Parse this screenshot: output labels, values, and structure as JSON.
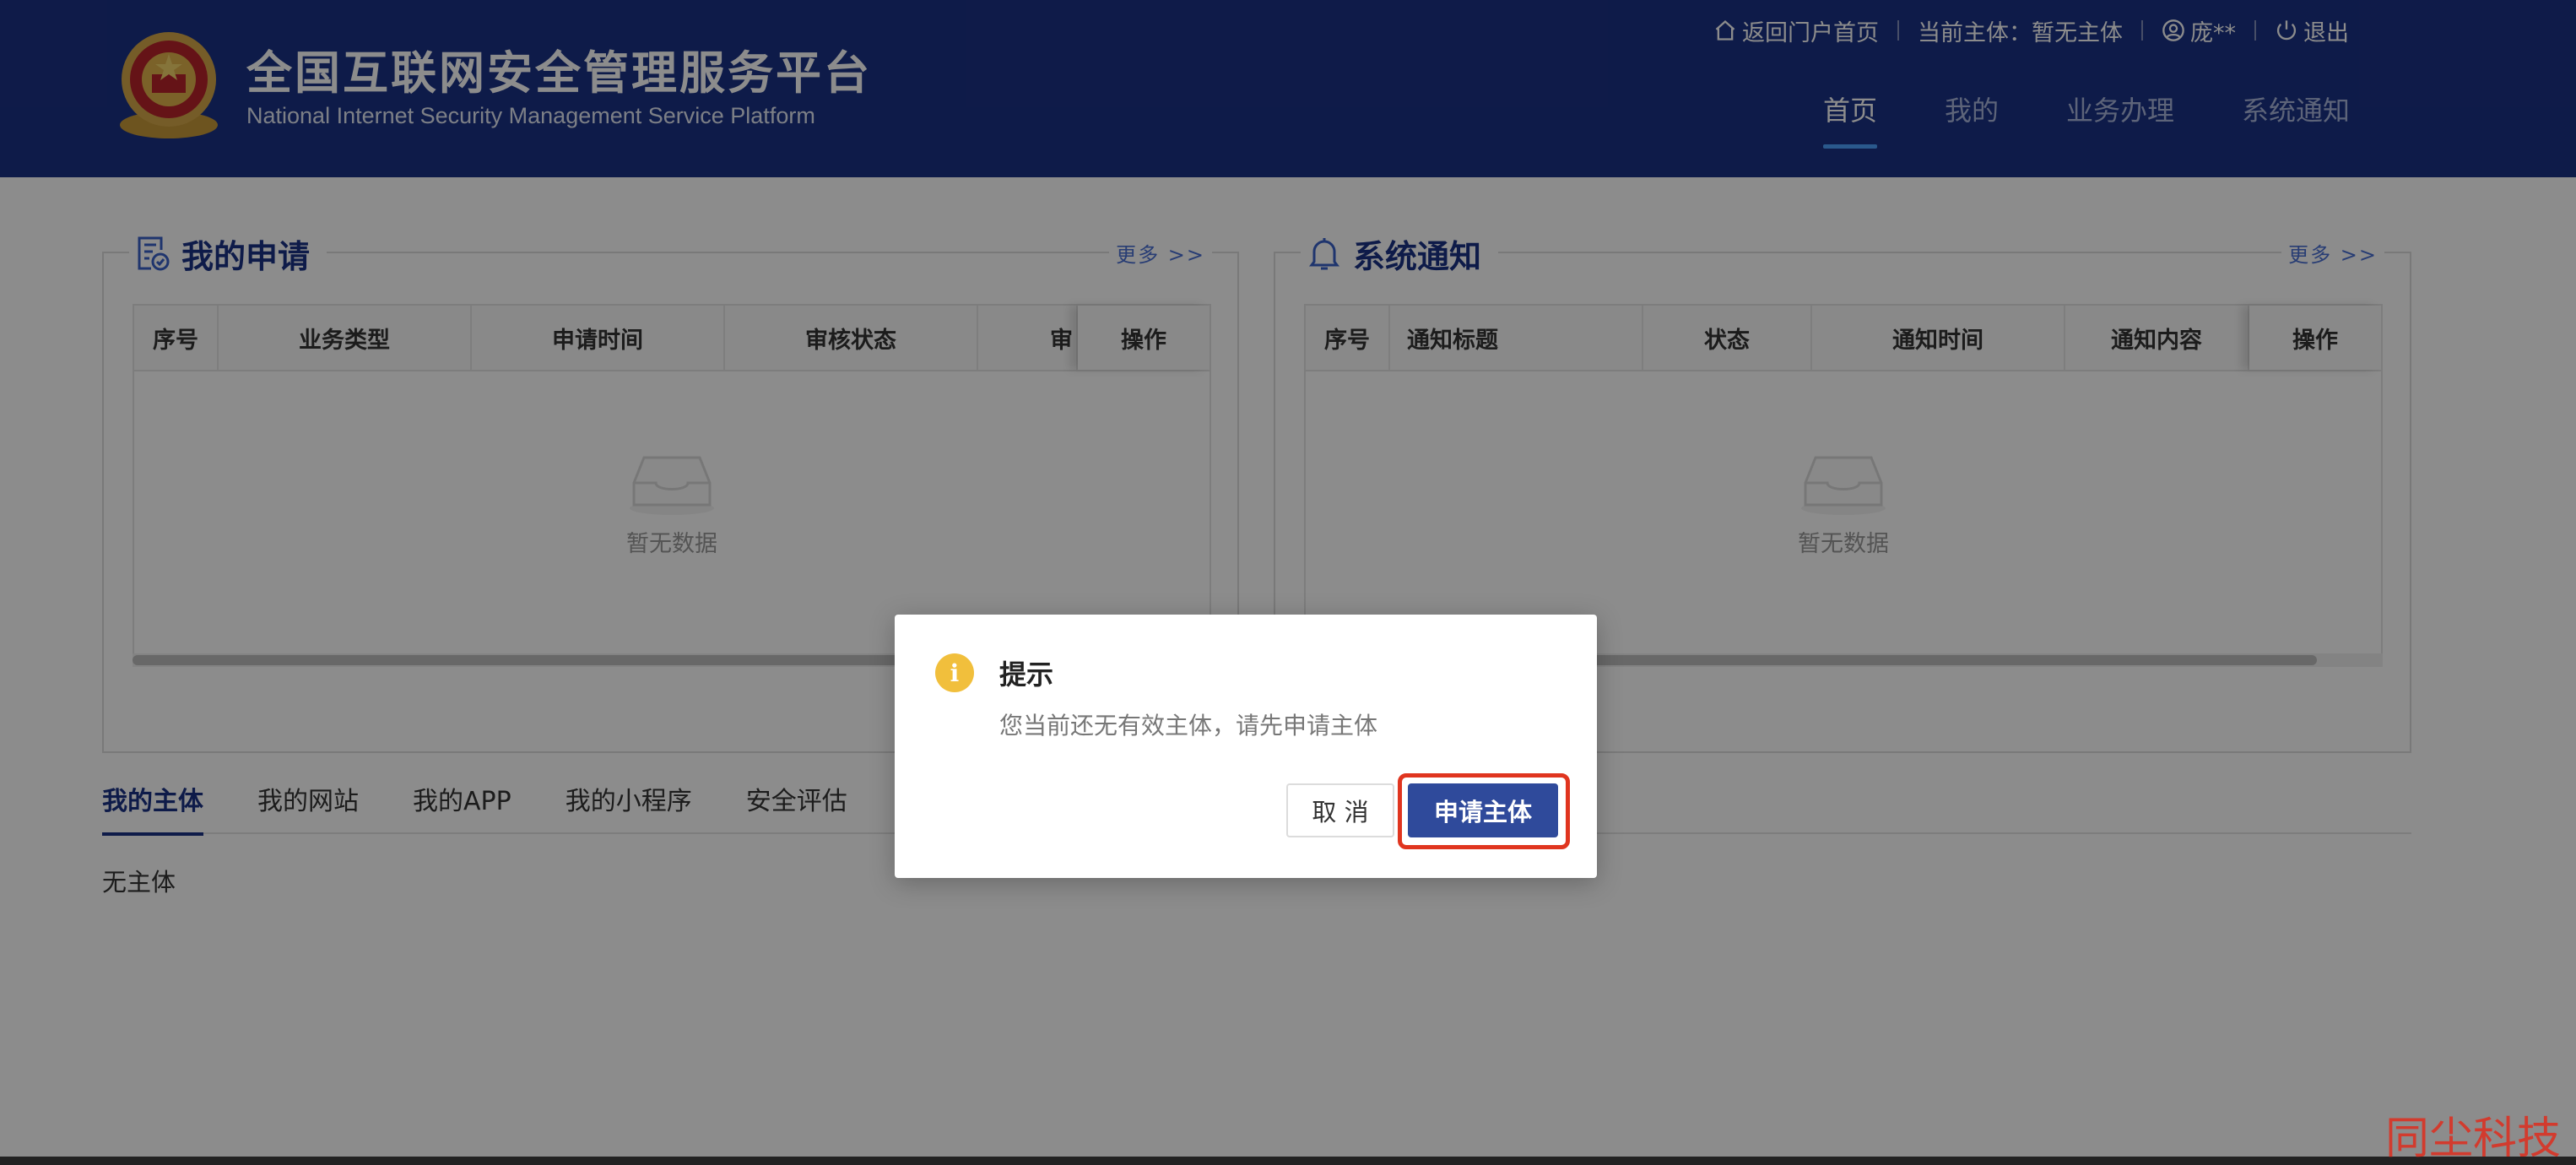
{
  "header": {
    "title": "全国互联网安全管理服务平台",
    "subtitle": "National Internet Security Management Service Platform",
    "topbar": {
      "home_link": "返回门户首页",
      "current_subject": "当前主体：暂无主体",
      "user": "庞**",
      "logout": "退出"
    },
    "nav": [
      "首页",
      "我的",
      "业务办理",
      "系统通知"
    ],
    "nav_active": "首页"
  },
  "my_applications": {
    "title": "我的申请",
    "more": "更多 >>",
    "columns": [
      "序号",
      "业务类型",
      "申请时间",
      "审核状态",
      "审",
      "操作"
    ],
    "empty_text": "暂无数据"
  },
  "system_notices": {
    "title": "系统通知",
    "more": "更多 >>",
    "columns": [
      "序号",
      "通知标题",
      "状态",
      "通知时间",
      "通知内容",
      "操作"
    ],
    "empty_text": "暂无数据"
  },
  "subject_tabs": {
    "items": [
      "我的主体",
      "我的网站",
      "我的APP",
      "我的小程序",
      "安全评估"
    ],
    "active": "我的主体",
    "content": "无主体"
  },
  "dialog": {
    "icon": "info-icon",
    "title": "提示",
    "message": "您当前还无有效主体，请先申请主体",
    "cancel_label": "取 消",
    "confirm_label": "申请主体"
  },
  "watermark": "同尘科技",
  "colors": {
    "header_bg": "#1b3285",
    "accent": "#2f4a9b",
    "warning": "#f1bf3c",
    "highlight": "#e0351f"
  }
}
